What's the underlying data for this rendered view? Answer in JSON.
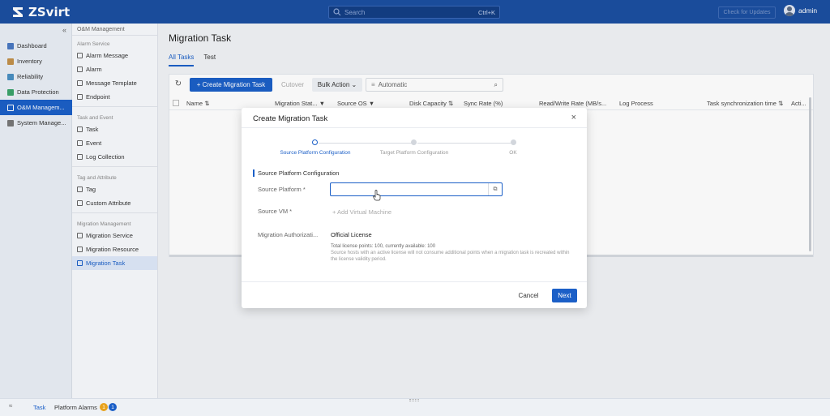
{
  "app": {
    "brand": "ZSvirt",
    "search_placeholder": "Search",
    "search_shortcut": "Ctrl+K",
    "check_updates_label": "Check for Updates",
    "user_name": "admin"
  },
  "sidebar": {
    "collapse_glyph": "«",
    "items": [
      {
        "label": "Dashboard",
        "icon": "dashboard-icon",
        "color": "#4a78c2"
      },
      {
        "label": "Inventory",
        "icon": "inventory-icon",
        "color": "#c2904a"
      },
      {
        "label": "Reliability",
        "icon": "reliability-icon",
        "color": "#4a8fc2"
      },
      {
        "label": "Data Protection",
        "icon": "data-protection-icon",
        "color": "#3aa36a"
      },
      {
        "label": "O&M Managem...",
        "icon": "om-management-icon",
        "color": "#ffffff",
        "active": true
      },
      {
        "label": "System Manage...",
        "icon": "system-management-icon",
        "color": "#777777"
      }
    ]
  },
  "subnav": {
    "title": "O&M Management",
    "groups": [
      {
        "title": "Alarm Service",
        "items": [
          "Alarm Message",
          "Alarm",
          "Message Template",
          "Endpoint"
        ]
      },
      {
        "title": "Task and Event",
        "items": [
          "Task",
          "Event",
          "Log Collection"
        ]
      },
      {
        "title": "Tag and Attribute",
        "items": [
          "Tag",
          "Custom Attribute"
        ]
      },
      {
        "title": "Migration Management",
        "items": [
          "Migration Service",
          "Migration Resource",
          "Migration Task"
        ]
      }
    ]
  },
  "main": {
    "title": "Migration Task",
    "tabs": [
      {
        "label": "All Tasks",
        "active": true
      },
      {
        "label": "Test",
        "active": false
      }
    ],
    "toolbar": {
      "refresh_glyph": "↻",
      "create_label": "+ Create Migration Task",
      "cutover_label": "Cutover",
      "bulk_label": "Bulk Action ⌄",
      "filter_text": "Automatic",
      "filter_glyph": "≡",
      "search_glyph": "⌕"
    },
    "columns": [
      "Name ⇅",
      "Migration Stat... ▼",
      "Source OS ▼",
      "Disk Capacity ⇅",
      "Sync Rate (%)",
      "Read/Write Rate (MB/s...",
      "Log Process",
      "Task synchronization time ⇅",
      "Acti..."
    ]
  },
  "modal": {
    "title": "Create Migration Task",
    "close_glyph": "×",
    "steps": [
      {
        "label": "Source Platform Configuration",
        "state": "current"
      },
      {
        "label": "Target Platform Configuration",
        "state": "pending"
      },
      {
        "label": "OK",
        "state": "pending"
      }
    ],
    "section_title": "Source Platform Configuration",
    "fields": {
      "source_platform_label": "Source Platform *",
      "source_platform_value": "",
      "picker_glyph": "⧉",
      "source_vm_label": "Source VM *",
      "add_vm_label": "+ Add Virtual Machine",
      "auth_label": "Migration Authorizati...",
      "license_type": "Official License",
      "license_points": "Total license points: 100, currently available: 100",
      "license_note": "Source hosts with an active license will not consume additional points when a migration task is recreated within the license validity period."
    },
    "cancel_label": "Cancel",
    "next_label": "Next"
  },
  "bottombar": {
    "expand_glyph": "≈",
    "task_label": "Task",
    "alarms_label": "Platform Alarms",
    "warn_count": "1",
    "info_count": "1",
    "colors": {
      "warn": "#e8a21c",
      "info": "#1b5fc7"
    }
  },
  "theme": {
    "primary": "#1b5fc7",
    "topbar": "#1b4fa0"
  }
}
